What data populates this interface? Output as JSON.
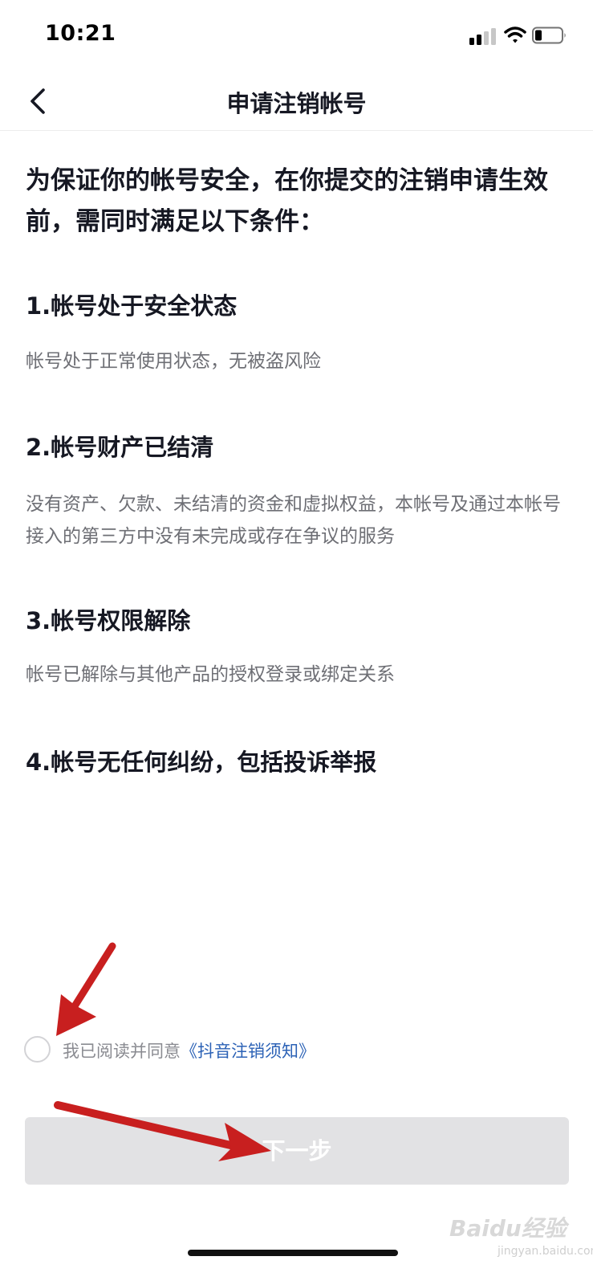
{
  "status_bar": {
    "time": "10:21"
  },
  "nav": {
    "title": "申请注销帐号"
  },
  "intro": "为保证你的帐号安全，在你提交的注销申请生效前，需同时满足以下条件：",
  "conditions": [
    {
      "title": "1.帐号处于安全状态",
      "desc": "帐号处于正常使用状态，无被盗风险"
    },
    {
      "title": "2.帐号财产已结清",
      "desc": "没有资产、欠款、未结清的资金和虚拟权益，本帐号及通过本帐号接入的第三方中没有未完成或存在争议的服务"
    },
    {
      "title": "3.帐号权限解除",
      "desc": "帐号已解除与其他产品的授权登录或绑定关系"
    },
    {
      "title": "4.帐号无任何纠纷，包括投诉举报",
      "desc": ""
    }
  ],
  "agreement": {
    "prefix": "我已阅读并同意",
    "link": "《抖音注销须知》",
    "checked": false
  },
  "next_button": {
    "label": "下一步",
    "enabled": false
  },
  "watermark": {
    "text": "Baidu经验",
    "sub": "jingyan.baidu.com"
  },
  "colors": {
    "link": "#2c62b6",
    "button_disabled": "#e2e2e4",
    "arrow": "#c81f1f",
    "secondary_text": "#6e6f75"
  }
}
